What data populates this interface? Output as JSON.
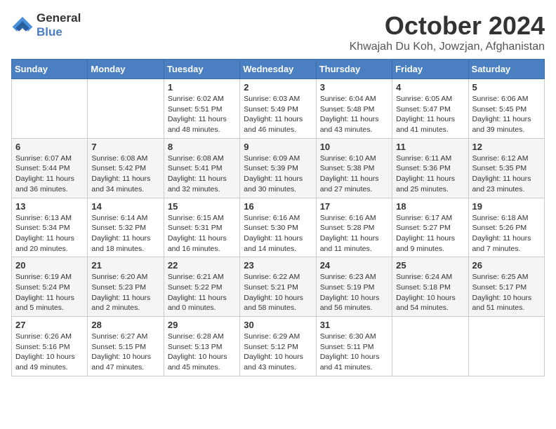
{
  "header": {
    "logo_line1": "General",
    "logo_line2": "Blue",
    "month_title": "October 2024",
    "location": "Khwajah Du Koh, Jowzjan, Afghanistan"
  },
  "days_of_week": [
    "Sunday",
    "Monday",
    "Tuesday",
    "Wednesday",
    "Thursday",
    "Friday",
    "Saturday"
  ],
  "weeks": [
    [
      {
        "day": "",
        "info": ""
      },
      {
        "day": "",
        "info": ""
      },
      {
        "day": "1",
        "info": "Sunrise: 6:02 AM\nSunset: 5:51 PM\nDaylight: 11 hours and 48 minutes."
      },
      {
        "day": "2",
        "info": "Sunrise: 6:03 AM\nSunset: 5:49 PM\nDaylight: 11 hours and 46 minutes."
      },
      {
        "day": "3",
        "info": "Sunrise: 6:04 AM\nSunset: 5:48 PM\nDaylight: 11 hours and 43 minutes."
      },
      {
        "day": "4",
        "info": "Sunrise: 6:05 AM\nSunset: 5:47 PM\nDaylight: 11 hours and 41 minutes."
      },
      {
        "day": "5",
        "info": "Sunrise: 6:06 AM\nSunset: 5:45 PM\nDaylight: 11 hours and 39 minutes."
      }
    ],
    [
      {
        "day": "6",
        "info": "Sunrise: 6:07 AM\nSunset: 5:44 PM\nDaylight: 11 hours and 36 minutes."
      },
      {
        "day": "7",
        "info": "Sunrise: 6:08 AM\nSunset: 5:42 PM\nDaylight: 11 hours and 34 minutes."
      },
      {
        "day": "8",
        "info": "Sunrise: 6:08 AM\nSunset: 5:41 PM\nDaylight: 11 hours and 32 minutes."
      },
      {
        "day": "9",
        "info": "Sunrise: 6:09 AM\nSunset: 5:39 PM\nDaylight: 11 hours and 30 minutes."
      },
      {
        "day": "10",
        "info": "Sunrise: 6:10 AM\nSunset: 5:38 PM\nDaylight: 11 hours and 27 minutes."
      },
      {
        "day": "11",
        "info": "Sunrise: 6:11 AM\nSunset: 5:36 PM\nDaylight: 11 hours and 25 minutes."
      },
      {
        "day": "12",
        "info": "Sunrise: 6:12 AM\nSunset: 5:35 PM\nDaylight: 11 hours and 23 minutes."
      }
    ],
    [
      {
        "day": "13",
        "info": "Sunrise: 6:13 AM\nSunset: 5:34 PM\nDaylight: 11 hours and 20 minutes."
      },
      {
        "day": "14",
        "info": "Sunrise: 6:14 AM\nSunset: 5:32 PM\nDaylight: 11 hours and 18 minutes."
      },
      {
        "day": "15",
        "info": "Sunrise: 6:15 AM\nSunset: 5:31 PM\nDaylight: 11 hours and 16 minutes."
      },
      {
        "day": "16",
        "info": "Sunrise: 6:16 AM\nSunset: 5:30 PM\nDaylight: 11 hours and 14 minutes."
      },
      {
        "day": "17",
        "info": "Sunrise: 6:16 AM\nSunset: 5:28 PM\nDaylight: 11 hours and 11 minutes."
      },
      {
        "day": "18",
        "info": "Sunrise: 6:17 AM\nSunset: 5:27 PM\nDaylight: 11 hours and 9 minutes."
      },
      {
        "day": "19",
        "info": "Sunrise: 6:18 AM\nSunset: 5:26 PM\nDaylight: 11 hours and 7 minutes."
      }
    ],
    [
      {
        "day": "20",
        "info": "Sunrise: 6:19 AM\nSunset: 5:24 PM\nDaylight: 11 hours and 5 minutes."
      },
      {
        "day": "21",
        "info": "Sunrise: 6:20 AM\nSunset: 5:23 PM\nDaylight: 11 hours and 2 minutes."
      },
      {
        "day": "22",
        "info": "Sunrise: 6:21 AM\nSunset: 5:22 PM\nDaylight: 11 hours and 0 minutes."
      },
      {
        "day": "23",
        "info": "Sunrise: 6:22 AM\nSunset: 5:21 PM\nDaylight: 10 hours and 58 minutes."
      },
      {
        "day": "24",
        "info": "Sunrise: 6:23 AM\nSunset: 5:19 PM\nDaylight: 10 hours and 56 minutes."
      },
      {
        "day": "25",
        "info": "Sunrise: 6:24 AM\nSunset: 5:18 PM\nDaylight: 10 hours and 54 minutes."
      },
      {
        "day": "26",
        "info": "Sunrise: 6:25 AM\nSunset: 5:17 PM\nDaylight: 10 hours and 51 minutes."
      }
    ],
    [
      {
        "day": "27",
        "info": "Sunrise: 6:26 AM\nSunset: 5:16 PM\nDaylight: 10 hours and 49 minutes."
      },
      {
        "day": "28",
        "info": "Sunrise: 6:27 AM\nSunset: 5:15 PM\nDaylight: 10 hours and 47 minutes."
      },
      {
        "day": "29",
        "info": "Sunrise: 6:28 AM\nSunset: 5:13 PM\nDaylight: 10 hours and 45 minutes."
      },
      {
        "day": "30",
        "info": "Sunrise: 6:29 AM\nSunset: 5:12 PM\nDaylight: 10 hours and 43 minutes."
      },
      {
        "day": "31",
        "info": "Sunrise: 6:30 AM\nSunset: 5:11 PM\nDaylight: 10 hours and 41 minutes."
      },
      {
        "day": "",
        "info": ""
      },
      {
        "day": "",
        "info": ""
      }
    ]
  ]
}
